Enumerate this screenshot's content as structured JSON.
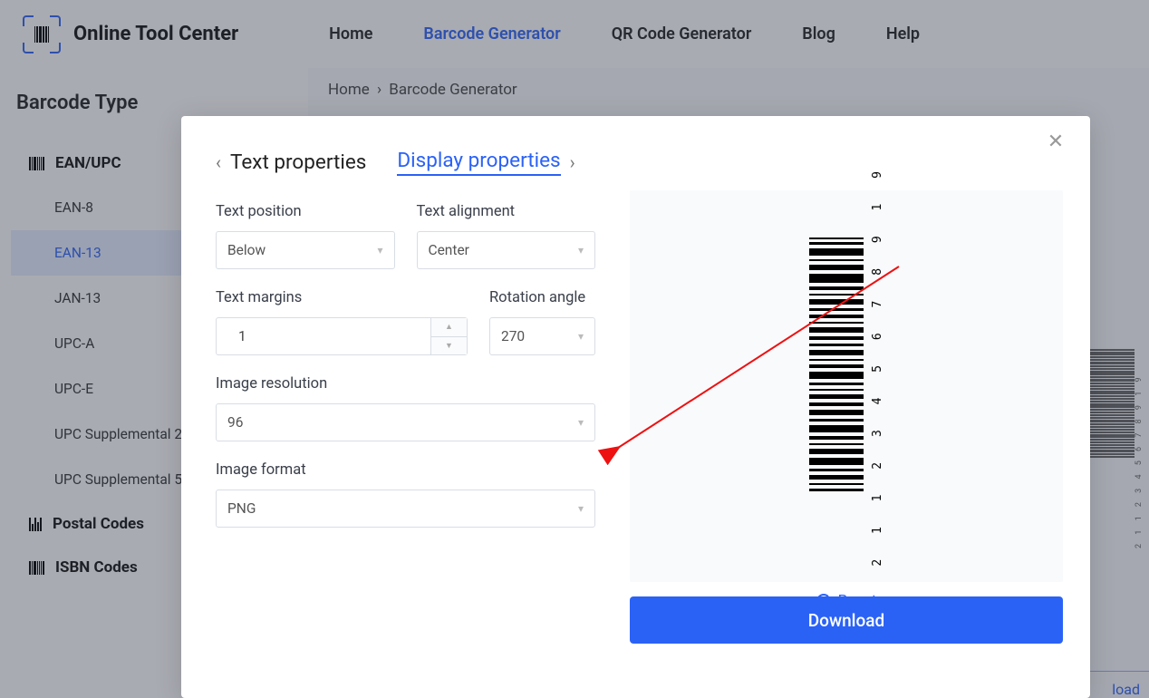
{
  "brand": "Online Tool Center",
  "nav": {
    "items": [
      {
        "label": "Home",
        "active": false
      },
      {
        "label": "Barcode Generator",
        "active": true
      },
      {
        "label": "QR Code Generator",
        "active": false
      },
      {
        "label": "Blog",
        "active": false
      },
      {
        "label": "Help",
        "active": false
      }
    ]
  },
  "breadcrumb": {
    "home": "Home",
    "current": "Barcode Generator"
  },
  "sidebar": {
    "title": "Barcode Type",
    "groups": [
      {
        "label": "EAN/UPC",
        "items": [
          {
            "label": "EAN-8",
            "active": false
          },
          {
            "label": "EAN-13",
            "active": true
          },
          {
            "label": "JAN-13",
            "active": false
          },
          {
            "label": "UPC-A",
            "active": false
          },
          {
            "label": "UPC-E",
            "active": false
          },
          {
            "label": "UPC Supplemental 2",
            "active": false
          },
          {
            "label": "UPC Supplemental 5",
            "active": false
          }
        ]
      },
      {
        "label": "Postal Codes",
        "items": []
      },
      {
        "label": "ISBN Codes",
        "items": []
      }
    ]
  },
  "bg": {
    "download_label": "load",
    "barcode_digits": "2 1 1 2 3 4 5 6 7 8 9 1 9"
  },
  "modal": {
    "tabs": {
      "prev": "Text properties",
      "active": "Display properties"
    },
    "close_symbol": "✕",
    "fields": {
      "text_position": {
        "label": "Text position",
        "value": "Below"
      },
      "text_alignment": {
        "label": "Text alignment",
        "value": "Center"
      },
      "text_margins": {
        "label": "Text margins",
        "value": "1"
      },
      "rotation_angle": {
        "label": "Rotation angle",
        "value": "270"
      },
      "image_resolution": {
        "label": "Image resolution",
        "value": "96"
      },
      "image_format": {
        "label": "Image format",
        "value": "PNG"
      }
    },
    "preview": {
      "digits": "2 1 1 2 3 4 5 6 7 8 9 1 9"
    },
    "reset_label": "Reset",
    "download_label": "Download"
  }
}
